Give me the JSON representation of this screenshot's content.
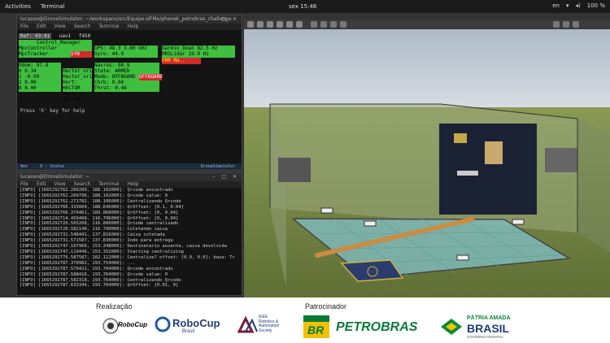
{
  "topbar": {
    "activities": "Activities",
    "terminal": "Terminal",
    "clock": "sex 15:46",
    "lang": "en",
    "battery": "100 %"
  },
  "term1": {
    "title": "lucasoo@DroneSimulator: ~/workspace/src/Equipe-UFMe/phenek_petrobras_challenge",
    "menu": [
      "File",
      "Edit",
      "View",
      "Search",
      "Terminal",
      "Help"
    ],
    "top_tabs": [
      "Ref: 43:41",
      "uav1",
      "f450"
    ],
    "panel_header": "Control_Manager",
    "col1": [
      "MpcController",
      "MpcTracker"
    ],
    "col1_right": "SYN",
    "col2": [
      "GPS: 48.3",
      "Gyro: 44.9"
    ],
    "col2_right": "3.60 GHz",
    "col3": [
      "Garmin_Down",
      "MRSLidar"
    ],
    "col3_right": "82.5 Hz",
    "col3_right2": "19.9 Hz",
    "errmsg": "ERR Ma..",
    "row2_a": [
      "Odom: 97.8",
      "0  0.34",
      "1 -0.00",
      "2  0.00",
      "N  8.00"
    ],
    "row2_b": [
      "Hector_origin",
      "Hector_origin",
      "Hort: HECTOR",
      "Hort: HECTOR"
    ],
    "row2_c": [
      "Navros: 98.9",
      "State: ARMED",
      "Mode: OFFBOARD",
      "Chrb: 0.94",
      "Thrst: 0.46"
    ],
    "row2_c_right": "OFFBOARD",
    "hint": "Press 'h' key for help",
    "tabs": [
      "4ev",
      "0 : Status",
      "",
      "DroneSimulator"
    ]
  },
  "term2": {
    "title": "lucasoo@DroneSimulator: ~",
    "menu": [
      "File",
      "Edit",
      "View",
      "Search",
      "Terminal",
      "Help"
    ],
    "lines": [
      "[INFO] [1665292762.260299, 188.102000]: Qrcode encontrado",
      "[INFO] [1665292762.269796, 188.102000]: Qrcode value: 0",
      "[INFO] [1665292762.271782, 188.106000]: Centralizando Qrcode",
      "[INFO] [1665292766.315604, 188.646000]: QrOffset: [0.1, 0.04]",
      "[INFO] [1665292766.379461, 189.068000]: QrOffset: [0, 0.04]",
      "[INFO] [1665292714.459408, 116.796000]: QrOffset: [0, 0.04]",
      "[INFO] [1665292720.565208, 116.800000]: Qrcode centralizado",
      "[INFO] [1665292720.582148, 116.790000]: Coletando caixa",
      "[INFO] [1665292731.548441, 137.816000]: Caixa coletada",
      "[INFO] [1665292731.571587, 137.830000]: Indo para entrega",
      "[INFO] [1665292747.107966, 153.348000]: Destinatario ausente, caixa devolvida",
      "[INFO] [1665292747.119446, 153.352000]: Starting centralizing",
      "[INFO] [1665292776.587587, 182.112000]: Centralize? offset: [0.0, 0.0]; base: Tr",
      "[INFO] [1665292787.370982, 193.754000]: ...",
      "[INFO] [1665292787.579421, 193.764000]: Qrcode encontrado",
      "[INFO] [1665292787.588416, 193.764000]: Qrcode value: 0",
      "[INFO] [1665292787.582318, 193.764000]: Centralizando Qrcode",
      "[INFO] [1665292787.633344, 193.764000]: QrOffset: [0.01, 0]"
    ]
  },
  "footer": {
    "realizacao": "Realização",
    "patrocinador": "Patrocinador",
    "robocup1": "RoboCup",
    "robocup2": "RoboCup",
    "robocup2_sub": "Brasil",
    "ieee_1": "IEEE",
    "ieee_2": "Robotics &",
    "ieee_3": "Automation",
    "ieee_4": "Society",
    "br": "BR",
    "petrobras": "PETROBRAS",
    "patria": "PÁTRIA AMADA",
    "brasil": "BRASIL",
    "gov": "GOVERNO FEDERAL"
  }
}
